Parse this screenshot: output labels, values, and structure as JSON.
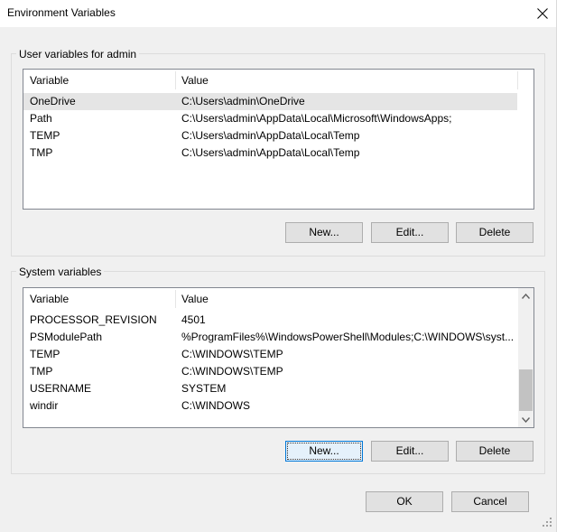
{
  "window": {
    "title": "Environment Variables"
  },
  "user_section": {
    "label": "User variables for admin",
    "columns": [
      "Variable",
      "Value"
    ],
    "rows": [
      {
        "variable": "OneDrive",
        "value": "C:\\Users\\admin\\OneDrive",
        "selected": true
      },
      {
        "variable": "Path",
        "value": "C:\\Users\\admin\\AppData\\Local\\Microsoft\\WindowsApps;"
      },
      {
        "variable": "TEMP",
        "value": "C:\\Users\\admin\\AppData\\Local\\Temp"
      },
      {
        "variable": "TMP",
        "value": "C:\\Users\\admin\\AppData\\Local\\Temp"
      }
    ],
    "buttons": {
      "new": "New...",
      "edit": "Edit...",
      "delete": "Delete"
    }
  },
  "system_section": {
    "label": "System variables",
    "columns": [
      "Variable",
      "Value"
    ],
    "rows": [
      {
        "variable": "PROCESSOR_REVISION",
        "value": "4501"
      },
      {
        "variable": "PSModulePath",
        "value": "%ProgramFiles%\\WindowsPowerShell\\Modules;C:\\WINDOWS\\syst..."
      },
      {
        "variable": "TEMP",
        "value": "C:\\WINDOWS\\TEMP"
      },
      {
        "variable": "TMP",
        "value": "C:\\WINDOWS\\TEMP"
      },
      {
        "variable": "USERNAME",
        "value": "SYSTEM"
      },
      {
        "variable": "windir",
        "value": "C:\\WINDOWS"
      }
    ],
    "buttons": {
      "new": "New...",
      "edit": "Edit...",
      "delete": "Delete"
    }
  },
  "footer": {
    "ok": "OK",
    "cancel": "Cancel"
  },
  "icons": {
    "close": "close-icon",
    "scroll_up": "chevron-up-icon",
    "scroll_down": "chevron-down-icon",
    "resize": "resize-grip-icon"
  },
  "colors": {
    "selection": "#e5e5e5",
    "focus_border": "#0078d7",
    "dialog_bg": "#f0f0f0"
  }
}
